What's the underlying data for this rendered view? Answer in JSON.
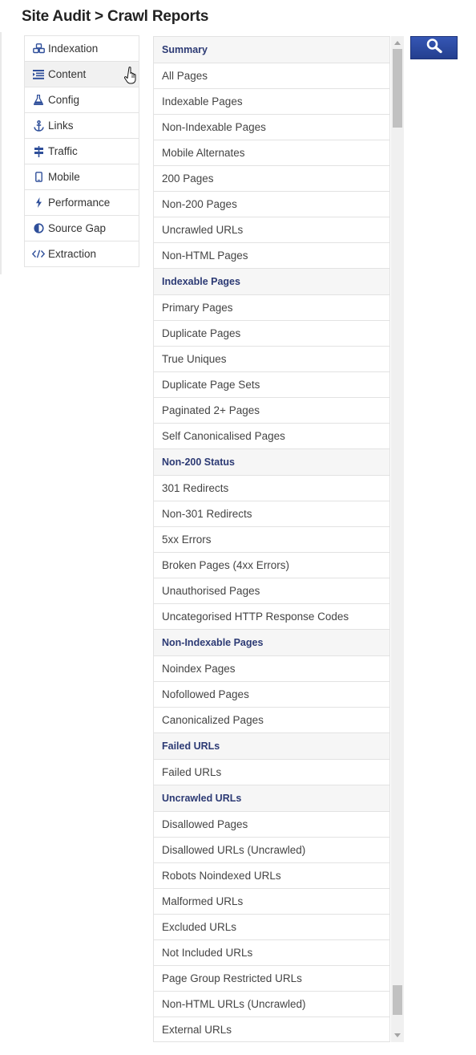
{
  "title": "Site Audit > Crawl Reports",
  "sidebar": {
    "items": [
      {
        "label": "Indexation",
        "icon": "cubes-icon",
        "active": false
      },
      {
        "label": "Content",
        "icon": "text-list-icon",
        "active": true
      },
      {
        "label": "Config",
        "icon": "flask-icon",
        "active": false
      },
      {
        "label": "Links",
        "icon": "anchor-icon",
        "active": false
      },
      {
        "label": "Traffic",
        "icon": "signpost-icon",
        "active": false
      },
      {
        "label": "Mobile",
        "icon": "mobile-icon",
        "active": false
      },
      {
        "label": "Performance",
        "icon": "bolt-icon",
        "active": false
      },
      {
        "label": "Source Gap",
        "icon": "half-circle-icon",
        "active": false
      },
      {
        "label": "Extraction",
        "icon": "code-icon",
        "active": false
      }
    ]
  },
  "reports": [
    {
      "label": "Summary",
      "header": true
    },
    {
      "label": "All Pages"
    },
    {
      "label": "Indexable Pages"
    },
    {
      "label": "Non-Indexable Pages"
    },
    {
      "label": "Mobile Alternates"
    },
    {
      "label": "200 Pages"
    },
    {
      "label": "Non-200 Pages"
    },
    {
      "label": "Uncrawled URLs"
    },
    {
      "label": "Non-HTML Pages"
    },
    {
      "label": "Indexable Pages",
      "header": true
    },
    {
      "label": "Primary Pages"
    },
    {
      "label": "Duplicate Pages"
    },
    {
      "label": "True Uniques"
    },
    {
      "label": "Duplicate Page Sets"
    },
    {
      "label": "Paginated 2+ Pages"
    },
    {
      "label": "Self Canonicalised Pages"
    },
    {
      "label": "Non-200 Status",
      "header": true
    },
    {
      "label": "301 Redirects"
    },
    {
      "label": "Non-301 Redirects"
    },
    {
      "label": "5xx Errors"
    },
    {
      "label": "Broken Pages (4xx Errors)"
    },
    {
      "label": "Unauthorised Pages"
    },
    {
      "label": "Uncategorised HTTP Response Codes"
    },
    {
      "label": "Non-Indexable Pages",
      "header": true
    },
    {
      "label": "Noindex Pages"
    },
    {
      "label": "Nofollowed Pages"
    },
    {
      "label": "Canonicalized Pages"
    },
    {
      "label": "Failed URLs",
      "header": true
    },
    {
      "label": "Failed URLs"
    },
    {
      "label": "Uncrawled URLs",
      "header": true
    },
    {
      "label": "Disallowed Pages"
    },
    {
      "label": "Disallowed URLs (Uncrawled)"
    },
    {
      "label": "Robots Noindexed URLs"
    },
    {
      "label": "Malformed URLs"
    },
    {
      "label": "Excluded URLs"
    },
    {
      "label": "Not Included URLs"
    },
    {
      "label": "Page Group Restricted URLs"
    },
    {
      "label": "Non-HTML URLs (Uncrawled)"
    },
    {
      "label": "External URLs"
    }
  ],
  "scrollbar": {
    "thumbs": [
      {
        "start": 0.0,
        "end": 0.08
      },
      {
        "start": 0.955,
        "end": 0.985
      }
    ]
  },
  "search_button": {
    "icon": "search-icon"
  },
  "colors": {
    "accent": "#2c3a74",
    "button": "#2c4aa3",
    "icon": "#2f4f9a"
  }
}
